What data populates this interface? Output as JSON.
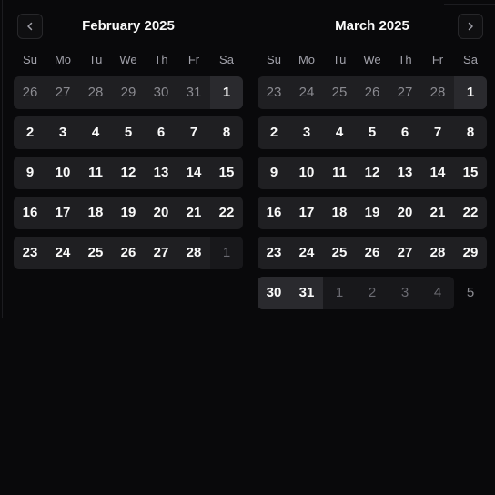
{
  "nav": {
    "prev_icon": "chevron-left-icon",
    "next_icon": "chevron-right-icon"
  },
  "weekdays": [
    "Su",
    "Mo",
    "Tu",
    "We",
    "Th",
    "Fr",
    "Sa"
  ],
  "months": [
    {
      "title": "February 2025",
      "weeks": [
        [
          {
            "d": "26",
            "o": true
          },
          {
            "d": "27",
            "o": true
          },
          {
            "d": "28",
            "o": true
          },
          {
            "d": "29",
            "o": true
          },
          {
            "d": "30",
            "o": true
          },
          {
            "d": "31",
            "o": true
          },
          {
            "d": "1",
            "o": false
          }
        ],
        [
          {
            "d": "2",
            "o": false
          },
          {
            "d": "3",
            "o": false
          },
          {
            "d": "4",
            "o": false
          },
          {
            "d": "5",
            "o": false
          },
          {
            "d": "6",
            "o": false
          },
          {
            "d": "7",
            "o": false
          },
          {
            "d": "8",
            "o": false
          }
        ],
        [
          {
            "d": "9",
            "o": false
          },
          {
            "d": "10",
            "o": false
          },
          {
            "d": "11",
            "o": false
          },
          {
            "d": "12",
            "o": false
          },
          {
            "d": "13",
            "o": false
          },
          {
            "d": "14",
            "o": false
          },
          {
            "d": "15",
            "o": false
          }
        ],
        [
          {
            "d": "16",
            "o": false
          },
          {
            "d": "17",
            "o": false
          },
          {
            "d": "18",
            "o": false
          },
          {
            "d": "19",
            "o": false
          },
          {
            "d": "20",
            "o": false
          },
          {
            "d": "21",
            "o": false
          },
          {
            "d": "22",
            "o": false
          }
        ],
        [
          {
            "d": "23",
            "o": false
          },
          {
            "d": "24",
            "o": false
          },
          {
            "d": "25",
            "o": false
          },
          {
            "d": "26",
            "o": false
          },
          {
            "d": "27",
            "o": false
          },
          {
            "d": "28",
            "o": false
          },
          {
            "d": "1",
            "o": true
          }
        ]
      ]
    },
    {
      "title": "March 2025",
      "weeks": [
        [
          {
            "d": "23",
            "o": true
          },
          {
            "d": "24",
            "o": true
          },
          {
            "d": "25",
            "o": true
          },
          {
            "d": "26",
            "o": true
          },
          {
            "d": "27",
            "o": true
          },
          {
            "d": "28",
            "o": true
          },
          {
            "d": "1",
            "o": false
          }
        ],
        [
          {
            "d": "2",
            "o": false
          },
          {
            "d": "3",
            "o": false
          },
          {
            "d": "4",
            "o": false
          },
          {
            "d": "5",
            "o": false
          },
          {
            "d": "6",
            "o": false
          },
          {
            "d": "7",
            "o": false
          },
          {
            "d": "8",
            "o": false
          }
        ],
        [
          {
            "d": "9",
            "o": false
          },
          {
            "d": "10",
            "o": false
          },
          {
            "d": "11",
            "o": false
          },
          {
            "d": "12",
            "o": false
          },
          {
            "d": "13",
            "o": false
          },
          {
            "d": "14",
            "o": false
          },
          {
            "d": "15",
            "o": false
          }
        ],
        [
          {
            "d": "16",
            "o": false
          },
          {
            "d": "17",
            "o": false
          },
          {
            "d": "18",
            "o": false
          },
          {
            "d": "19",
            "o": false
          },
          {
            "d": "20",
            "o": false
          },
          {
            "d": "21",
            "o": false
          },
          {
            "d": "22",
            "o": false
          }
        ],
        [
          {
            "d": "23",
            "o": false
          },
          {
            "d": "24",
            "o": false
          },
          {
            "d": "25",
            "o": false
          },
          {
            "d": "26",
            "o": false
          },
          {
            "d": "27",
            "o": false
          },
          {
            "d": "28",
            "o": false
          },
          {
            "d": "29",
            "o": false
          }
        ],
        [
          {
            "d": "30",
            "o": false
          },
          {
            "d": "31",
            "o": false
          },
          {
            "d": "1",
            "o": true
          },
          {
            "d": "2",
            "o": true
          },
          {
            "d": "3",
            "o": true
          },
          {
            "d": "4",
            "o": true
          },
          {
            "d": "5",
            "o": true
          }
        ]
      ]
    }
  ]
}
